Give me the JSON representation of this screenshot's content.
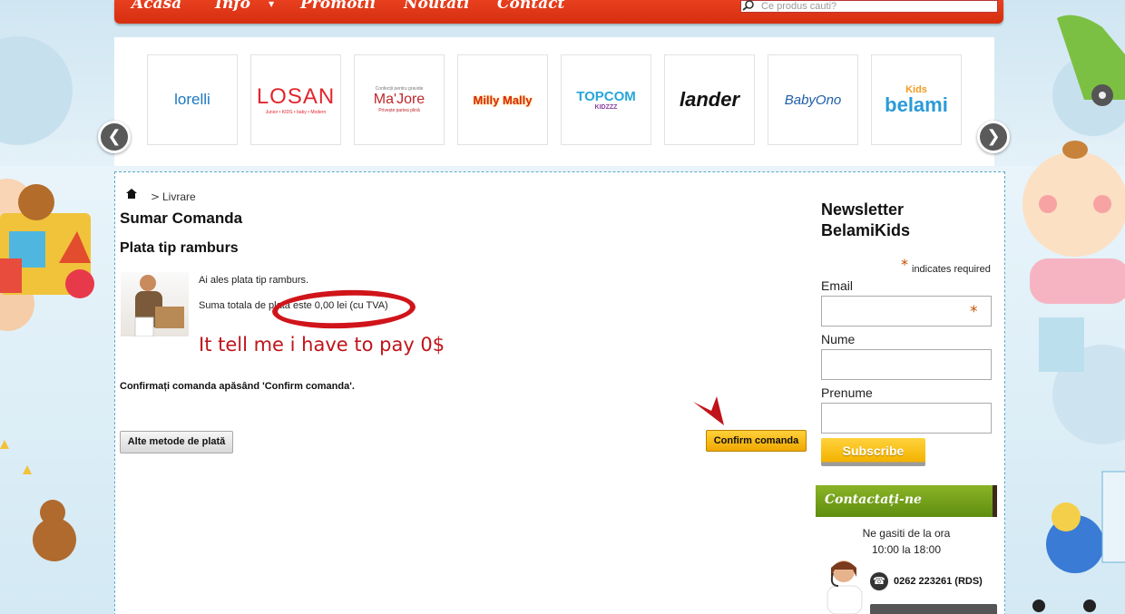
{
  "nav": {
    "items": [
      "Acasa",
      "Info",
      "Promotii",
      "Noutati",
      "Contact"
    ],
    "search_placeholder": "Ce produs cauti?"
  },
  "brands": [
    "lorelli",
    "LOSAN",
    "Ma'Jore",
    "Milly Mally",
    "TOPCOM KIDZZZ",
    "lander",
    "BabyOno",
    "Kids belami"
  ],
  "brand_sub": {
    "losan": "Junior • KIDS • baby • Modern",
    "majore_top": "Confecții pentru gravide",
    "majore_bottom": "Privește partea plină",
    "topcom_sub": "KIDZZZ"
  },
  "breadcrumb": {
    "current": "Livrare"
  },
  "main": {
    "title": "Sumar Comanda",
    "section": "Plata tip ramburs",
    "message_1": "Ai ales plata tip ramburs.",
    "message_2": "Suma totala de plata este 0,00 lei (cu TVA)",
    "annotation": "It tell me i have to pay 0$",
    "confirm_hint": "Confirmați comanda apăsând 'Confirm comanda'.",
    "btn_other": "Alte metode de plată",
    "btn_confirm": "Confirm comanda"
  },
  "newsletter": {
    "title": "Newsletter BelamiKids",
    "required_note": "indicates required",
    "email_label": "Email",
    "name_label": "Nume",
    "firstname_label": "Prenume",
    "subscribe": "Subscribe"
  },
  "contact": {
    "banner": "Contactați-ne",
    "hours_1": "Ne gasiti de la ora",
    "hours_2": "10:00 la 18:00",
    "phone": "0262 223261 (RDS)"
  },
  "colors": {
    "nav_red": "#d52e10",
    "annotation_red": "#c0141a",
    "confirm_yellow": "#f0a800",
    "contact_green": "#6e9c18"
  }
}
